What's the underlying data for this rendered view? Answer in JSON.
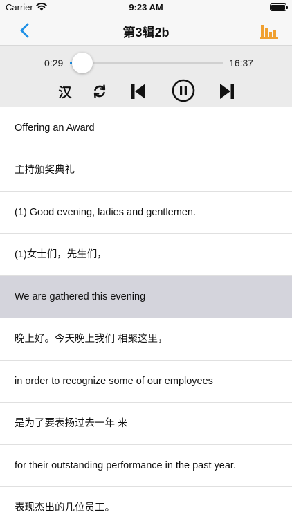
{
  "status_bar": {
    "carrier": "Carrier",
    "time": "9:23 AM"
  },
  "nav": {
    "title": "第3辑2b",
    "accent_color": "#1e90e6",
    "chart_color": "#f0a030"
  },
  "player": {
    "elapsed": "0:29",
    "total": "16:37",
    "progress_fraction": 0.029,
    "han_toggle_label": "汉",
    "state": "playing"
  },
  "lines": [
    {
      "text": "Offering an Award",
      "active": false
    },
    {
      "text": "主持颁奖典礼",
      "active": false
    },
    {
      "text": "(1) Good evening, ladies and gentlemen.",
      "active": false
    },
    {
      "text": "(1)女士们，先生们，",
      "active": false
    },
    {
      "text": "We are gathered this evening",
      "active": true
    },
    {
      "text": "晚上好。今天晚上我们 相聚这里，",
      "active": false
    },
    {
      "text": "in order to recognize some of our employees",
      "active": false
    },
    {
      "text": "是为了要表扬过去一年 来",
      "active": false
    },
    {
      "text": "for their outstanding performance in the past year.",
      "active": false
    },
    {
      "text": "表现杰出的几位员工。",
      "active": false
    }
  ]
}
